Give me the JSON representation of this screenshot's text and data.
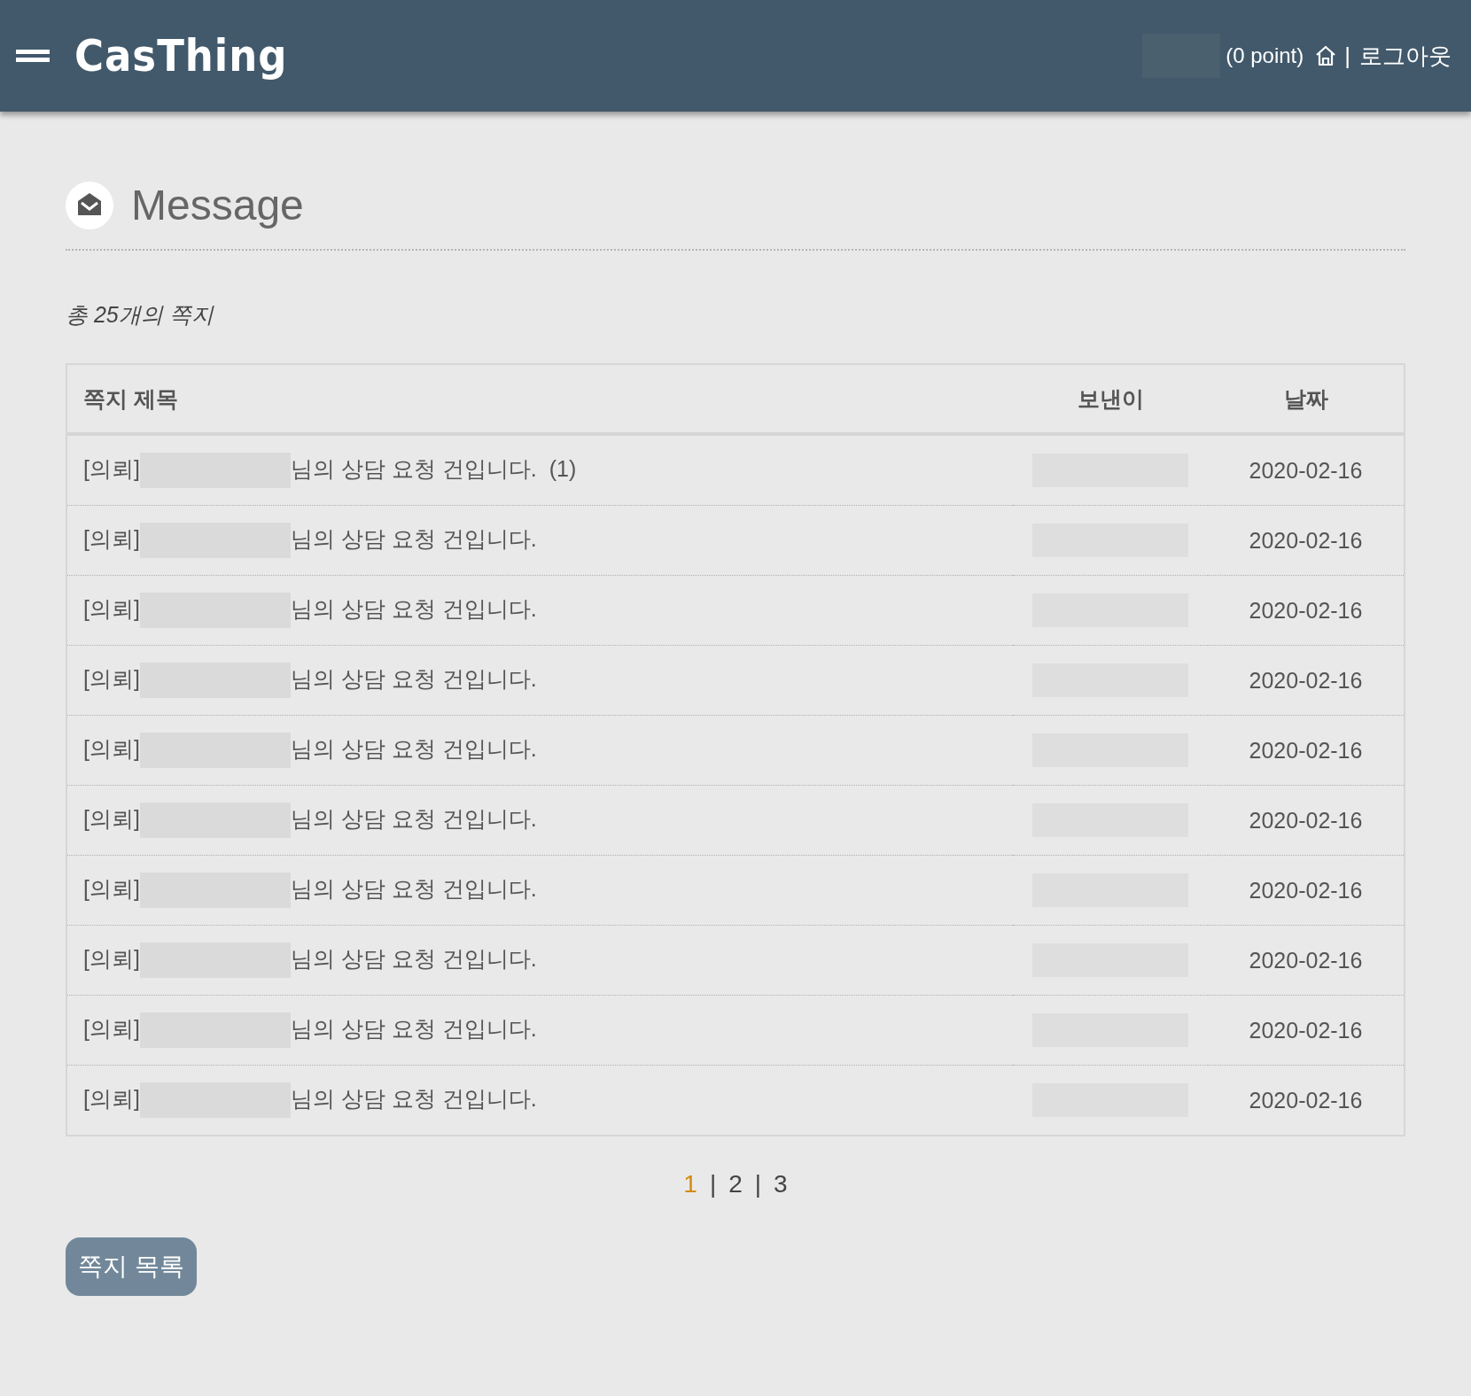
{
  "header": {
    "logo": "CasThing",
    "points": "(0 point)",
    "separator": "|",
    "logout": "로그아웃"
  },
  "page": {
    "title": "Message",
    "count": "총 25개의 쪽지"
  },
  "table": {
    "columns": [
      "쪽지 제목",
      "보낸이",
      "날짜"
    ],
    "rows": [
      {
        "prefix": "[의뢰]",
        "subject": "님의 상담 요청 건입니다.",
        "reply_count": "(1)",
        "date": "2020-02-16"
      },
      {
        "prefix": "[의뢰]",
        "subject": "님의 상담 요청 건입니다.",
        "date": "2020-02-16"
      },
      {
        "prefix": "[의뢰]",
        "subject": "님의 상담 요청 건입니다.",
        "date": "2020-02-16"
      },
      {
        "prefix": "[의뢰]",
        "subject": "님의 상담 요청 건입니다.",
        "date": "2020-02-16"
      },
      {
        "prefix": "[의뢰]",
        "subject": "님의 상담 요청 건입니다.",
        "date": "2020-02-16"
      },
      {
        "prefix": "[의뢰]",
        "subject": "님의 상담 요청 건입니다.",
        "date": "2020-02-16"
      },
      {
        "prefix": "[의뢰]",
        "subject": "님의 상담 요청 건입니다.",
        "date": "2020-02-16"
      },
      {
        "prefix": "[의뢰]",
        "subject": "님의 상담 요청 건입니다.",
        "date": "2020-02-16"
      },
      {
        "prefix": "[의뢰]",
        "subject": "님의 상담 요청 건입니다.",
        "date": "2020-02-16"
      },
      {
        "prefix": "[의뢰]",
        "subject": "님의 상담 요청 건입니다.",
        "date": "2020-02-16"
      }
    ]
  },
  "pagination": {
    "pages": [
      {
        "label": "1",
        "selected": true
      },
      {
        "label": "2",
        "selected": false
      },
      {
        "label": "3",
        "selected": false
      }
    ],
    "separators": [
      "|",
      "|"
    ]
  },
  "button": "쪽지 목록"
}
